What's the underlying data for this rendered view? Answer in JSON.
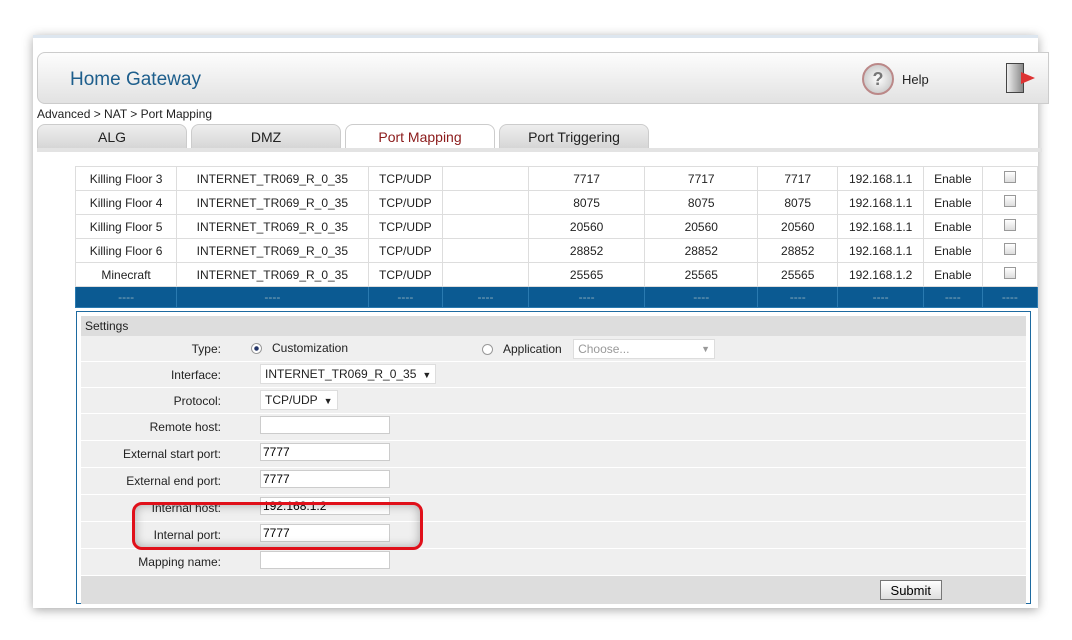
{
  "header": {
    "title": "Home Gateway",
    "help_label": "Help",
    "help_icon": "question-icon",
    "exit_icon": "logout-door-icon"
  },
  "breadcrumb": "Advanced > NAT > Port Mapping",
  "tabs": [
    {
      "label": "ALG"
    },
    {
      "label": "DMZ"
    },
    {
      "label": "Port Mapping",
      "active": true
    },
    {
      "label": "Port Triggering"
    }
  ],
  "rows": [
    [
      "Killing Floor 3",
      "INTERNET_TR069_R_0_35",
      "TCP/UDP",
      "",
      "7717",
      "7717",
      "7717",
      "192.168.1.1",
      "Enable"
    ],
    [
      "Killing Floor 4",
      "INTERNET_TR069_R_0_35",
      "TCP/UDP",
      "",
      "8075",
      "8075",
      "8075",
      "192.168.1.1",
      "Enable"
    ],
    [
      "Killing Floor 5",
      "INTERNET_TR069_R_0_35",
      "TCP/UDP",
      "",
      "20560",
      "20560",
      "20560",
      "192.168.1.1",
      "Enable"
    ],
    [
      "Killing Floor 6",
      "INTERNET_TR069_R_0_35",
      "TCP/UDP",
      "",
      "28852",
      "28852",
      "28852",
      "192.168.1.1",
      "Enable"
    ],
    [
      "Minecraft",
      "INTERNET_TR069_R_0_35",
      "TCP/UDP",
      "",
      "25565",
      "25565",
      "25565",
      "192.168.1.2",
      "Enable"
    ]
  ],
  "selected_row": [
    "----",
    "----",
    "----",
    "----",
    "----",
    "----",
    "----",
    "----",
    "----",
    "----"
  ],
  "settings": {
    "title": "Settings",
    "type_label": "Type:",
    "type_custom": "Customization",
    "type_app": "Application",
    "app_placeholder": "Choose...",
    "interface_label": "Interface:",
    "interface_value": "INTERNET_TR069_R_0_35",
    "protocol_label": "Protocol:",
    "protocol_value": "TCP/UDP",
    "remote_host_label": "Remote host:",
    "remote_host_value": "",
    "ext_start_label": "External start port:",
    "ext_start_value": "7777",
    "ext_end_label": "External end port:",
    "ext_end_value": "7777",
    "internal_host_label": "Internal host:",
    "internal_host_value": "192.168.1.2",
    "internal_port_label": "Internal port:",
    "internal_port_value": "7777",
    "mapping_name_label": "Mapping name:",
    "mapping_name_value": "",
    "submit_label": "Submit"
  },
  "colors": {
    "accent": "#0b5a92",
    "highlight": "#e0101a",
    "title": "#1d5e8c"
  }
}
